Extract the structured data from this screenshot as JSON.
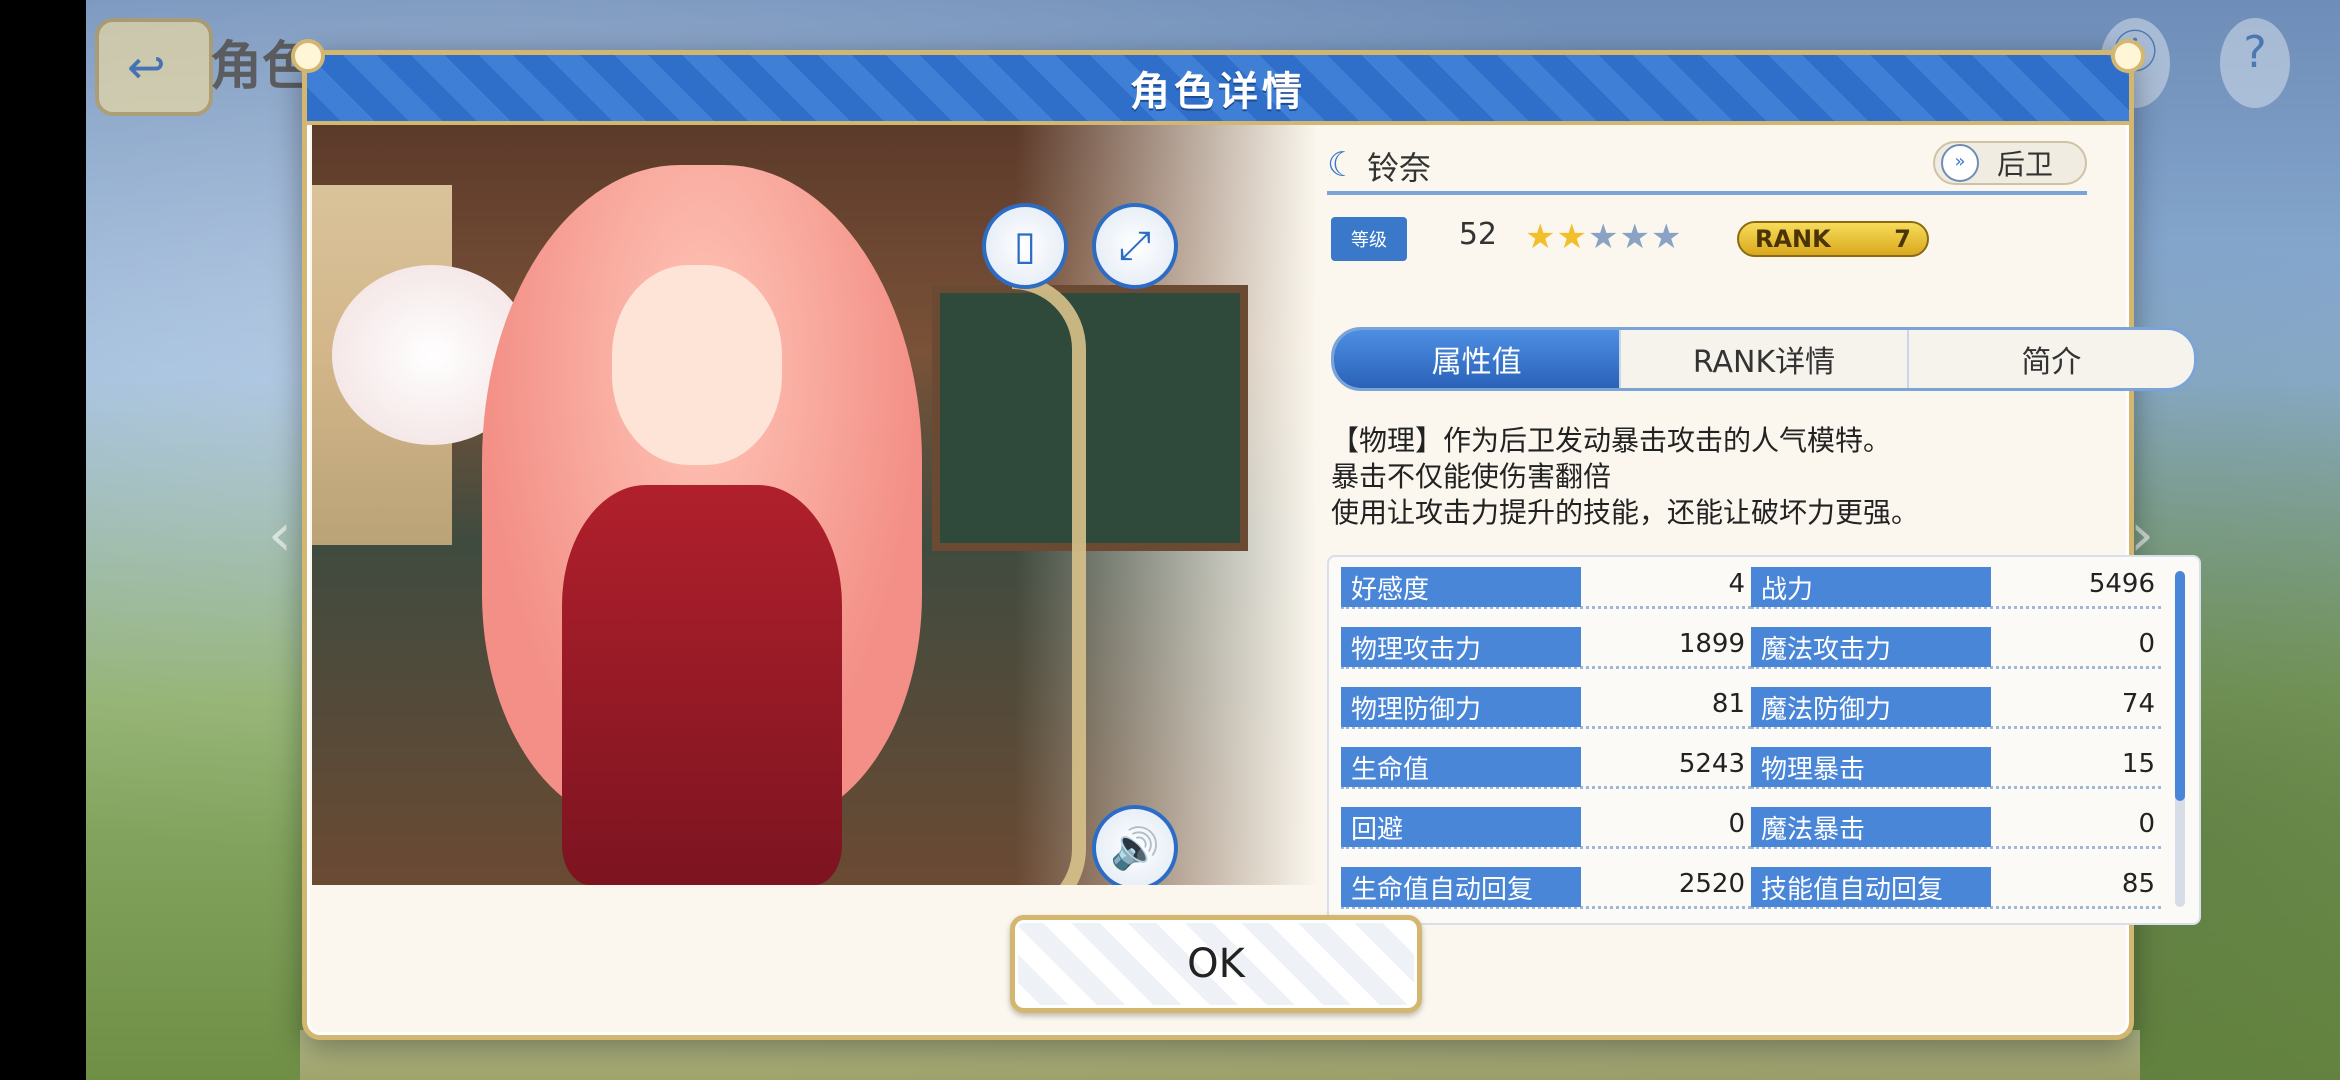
{
  "background": {
    "title": "角色",
    "back_icon": "back-arrow-icon"
  },
  "dialog": {
    "title": "角色详情",
    "ok_label": "OK"
  },
  "character": {
    "name": "铃奈",
    "role": "后卫",
    "level_tag": "等级",
    "level": "52",
    "stars_total": 5,
    "stars_filled": 2,
    "rank_label": "RANK",
    "rank_value": "7"
  },
  "tabs": [
    {
      "label": "属性值",
      "active": true
    },
    {
      "label": "RANK详情",
      "active": false
    },
    {
      "label": "简介",
      "active": false
    }
  ],
  "description": [
    "【物理】作为后卫发动暴击攻击的人气模特。",
    "暴击不仅能使伤害翻倍",
    "使用让攻击力提升的技能，还能让破坏力更强。"
  ],
  "stats": [
    {
      "label": "好感度",
      "value": "4"
    },
    {
      "label": "战力",
      "value": "5496"
    },
    {
      "label": "物理攻击力",
      "value": "1899"
    },
    {
      "label": "魔法攻击力",
      "value": "0"
    },
    {
      "label": "物理防御力",
      "value": "81"
    },
    {
      "label": "魔法防御力",
      "value": "74"
    },
    {
      "label": "生命值",
      "value": "5243"
    },
    {
      "label": "物理暴击",
      "value": "15"
    },
    {
      "label": "回避",
      "value": "0"
    },
    {
      "label": "魔法暴击",
      "value": "0"
    },
    {
      "label": "生命值自动回复",
      "value": "2520"
    },
    {
      "label": "技能值自动回复",
      "value": "85"
    }
  ],
  "colors": {
    "accent_blue": "#3a78c9",
    "gold": "#d3b670",
    "star_on": "#f2bf2a"
  }
}
